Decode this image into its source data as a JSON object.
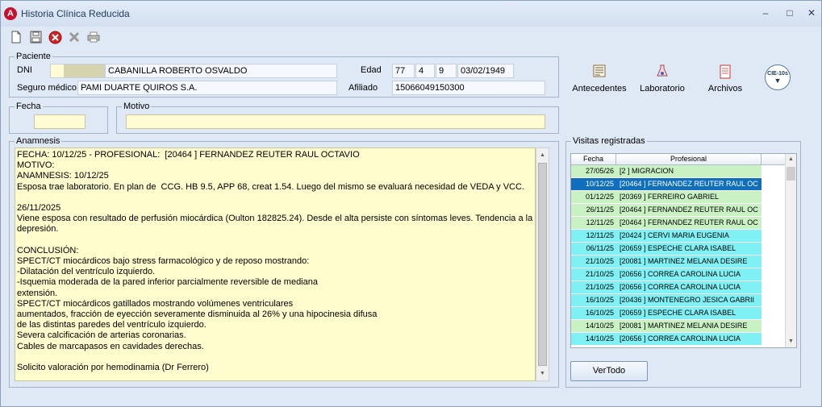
{
  "window": {
    "title": "Historia Clínica Reducida",
    "minimize": "‒",
    "maximize": "□",
    "close": "✕"
  },
  "toolbar": {
    "new_icon": "new-document-icon",
    "save_icon": "save-icon",
    "delete_icon": "delete-icon",
    "cancel_icon": "cancel-icon",
    "print_icon": "print-icon"
  },
  "paciente": {
    "group_label": "Paciente",
    "dni_label": "DNI",
    "name": "CABANILLA ROBERTO OSVALDO",
    "edad_label": "Edad",
    "edad_years": "77",
    "edad_months": "4",
    "edad_days": "9",
    "birth_date": "03/02/1949",
    "seguro_label": "Seguro médico",
    "seguro": "PAMI DUARTE QUIROS S.A.",
    "afiliado_label": "Afiliado",
    "afiliado": "15066049150300"
  },
  "actions": {
    "antecedentes": "Antecedentes",
    "laboratorio": "Laboratorio",
    "archivos": "Archivos",
    "cie_label": "CIE-10s"
  },
  "fecha_label": "Fecha",
  "motivo_label": "Motivo",
  "anamnesis": {
    "label": "Anamnesis",
    "text": "FECHA: 10/12/25 - PROFESIONAL:  [20464 ] FERNANDEZ REUTER RAUL OCTAVIO\nMOTIVO:\nANAMNESIS: 10/12/25\nEsposa trae laboratorio. En plan de  CCG. HB 9.5, APP 68, creat 1.54. Luego del mismo se evaluará necesidad de VEDA y VCC.\n\n26/11/2025\nViene esposa con resultado de perfusión miocárdica (Oulton 182825.24). Desde el alta persiste con síntomas leves. Tendencia a la\ndepresión.\n\nCONCLUSIÓN:\nSPECT/CT miocárdicos bajo stress farmacológico y de reposo mostrando:\n-Dilatación del ventrículo izquierdo.\n-Isquemia moderada de la pared inferior parcialmente reversible de mediana\nextensión.\nSPECT/CT miocárdicos gatillados mostrando volúmenes ventriculares\naumentados, fracción de eyección severamente disminuida al 26% y una hipocinesia difusa\nde las distintas paredes del ventrículo izquierdo.\nSevera calcificación de arterias coronarias.\nCables de marcapasos en cavidades derechas.\n\nSolicito valoración por hemodinamia (Dr Ferrero)"
  },
  "visitas": {
    "label": "Visitas registradas",
    "col_fecha": "Fecha",
    "col_profesional": "Profesional",
    "rows": [
      {
        "fecha": "27/05/26",
        "prof": "[2 ] MIGRACION",
        "style": "green"
      },
      {
        "fecha": "10/12/25",
        "prof": "[20464 ] FERNANDEZ REUTER RAUL OC",
        "style": "sel"
      },
      {
        "fecha": "01/12/25",
        "prof": "[20369 ] FERREIRO GABRIEL",
        "style": "green"
      },
      {
        "fecha": "26/11/25",
        "prof": "[20464 ] FERNANDEZ REUTER RAUL OC",
        "style": "green"
      },
      {
        "fecha": "12/11/25",
        "prof": "[20464 ] FERNANDEZ REUTER RAUL OC",
        "style": "green"
      },
      {
        "fecha": "12/11/25",
        "prof": "[20424 ] CERVI MARIA EUGENIA",
        "style": "cyan"
      },
      {
        "fecha": "06/11/25",
        "prof": "[20659 ] ESPECHE CLARA ISABEL",
        "style": "cyan"
      },
      {
        "fecha": "21/10/25",
        "prof": "[20081 ] MARTINEZ MELANIA DESIRE",
        "style": "cyan"
      },
      {
        "fecha": "21/10/25",
        "prof": "[20656 ] CORREA CAROLINA LUCIA",
        "style": "cyan"
      },
      {
        "fecha": "21/10/25",
        "prof": "[20656 ] CORREA CAROLINA LUCIA",
        "style": "cyan"
      },
      {
        "fecha": "16/10/25",
        "prof": "[20436 ] MONTENEGRO JESICA GABRII",
        "style": "cyan"
      },
      {
        "fecha": "16/10/25",
        "prof": "[20659 ] ESPECHE CLARA ISABEL",
        "style": "cyan"
      },
      {
        "fecha": "14/10/25",
        "prof": "[20081 ] MARTINEZ MELANIA DESIRE",
        "style": "green"
      },
      {
        "fecha": "14/10/25",
        "prof": "[20656 ] CORREA CAROLINA LUCIA",
        "style": "cyan"
      }
    ]
  },
  "ver_todo": "VerTodo"
}
